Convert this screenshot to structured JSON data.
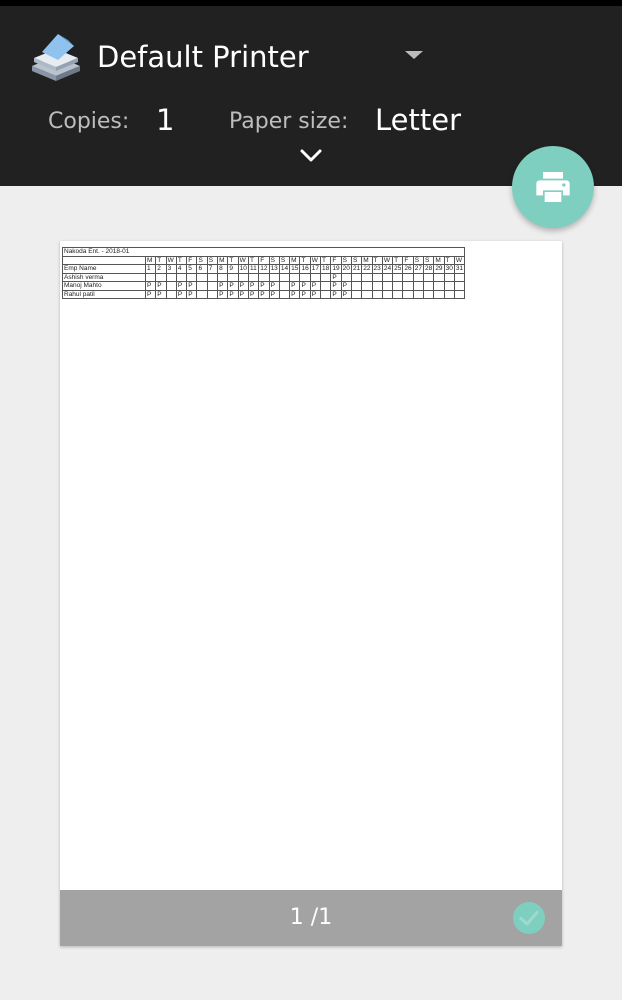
{
  "header": {
    "printer_name": "Default Printer",
    "copies_label": "Copies:",
    "copies_value": "1",
    "paper_size_label": "Paper size:",
    "paper_size_value": "Letter"
  },
  "icons": {
    "printer": "printer-stack-icon",
    "dropdown": "dropdown-arrow-icon",
    "expand": "chevron-down-icon",
    "fab": "print-icon",
    "page_selected": "check-circle-icon"
  },
  "colors": {
    "header_bg": "#212121",
    "fab": "#7ecfbf",
    "footer_bg": "#a3a3a3"
  },
  "preview": {
    "title": "Nakoda Ent. - 2018-01",
    "name_header": "Emp Name",
    "weekdays": [
      "M",
      "T",
      "W",
      "T",
      "F",
      "S",
      "S",
      "M",
      "T",
      "W",
      "T",
      "F",
      "S",
      "S",
      "M",
      "T",
      "W",
      "T",
      "F",
      "S",
      "S",
      "M",
      "T",
      "W",
      "T",
      "F",
      "S",
      "S",
      "M",
      "T",
      "W"
    ],
    "days": [
      "1",
      "2",
      "3",
      "4",
      "5",
      "6",
      "7",
      "8",
      "9",
      "10",
      "11",
      "12",
      "13",
      "14",
      "15",
      "16",
      "17",
      "18",
      "19",
      "20",
      "21",
      "22",
      "23",
      "24",
      "25",
      "26",
      "27",
      "28",
      "29",
      "30",
      "31"
    ],
    "rows": [
      {
        "name": "Ashish verma",
        "marks": [
          "",
          "",
          "",
          "",
          "",
          "",
          "",
          "",
          "",
          "",
          "",
          "",
          "",
          "",
          "",
          "",
          "",
          "",
          "P",
          "",
          "",
          "",
          "",
          "",
          "",
          "",
          "",
          "",
          "",
          "",
          ""
        ]
      },
      {
        "name": "Manoj Mahto",
        "marks": [
          "P",
          "P",
          "",
          "P",
          "P",
          "",
          "",
          "P",
          "P",
          "P",
          "P",
          "P",
          "P",
          "",
          "P",
          "P",
          "P",
          "",
          "P",
          "P",
          "",
          "",
          "",
          "",
          "",
          "",
          "",
          "",
          "",
          "",
          ""
        ]
      },
      {
        "name": "Rahul patil",
        "marks": [
          "P",
          "P",
          "",
          "P",
          "P",
          "",
          "",
          "P",
          "P",
          "P",
          "P",
          "P",
          "P",
          "",
          "P",
          "P",
          "P",
          "",
          "P",
          "P",
          "",
          "",
          "",
          "",
          "",
          "",
          "",
          "",
          "",
          "",
          ""
        ]
      }
    ]
  },
  "page_counter": "1 /1"
}
